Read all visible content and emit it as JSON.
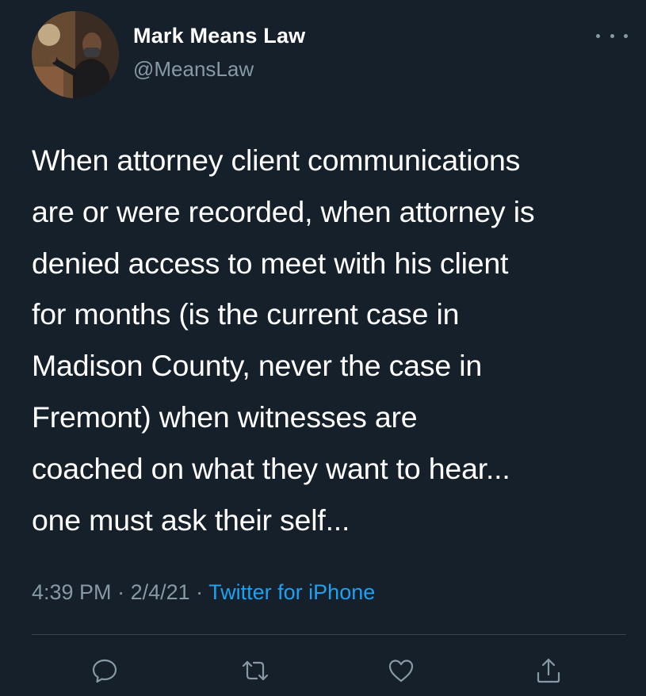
{
  "tweet": {
    "author_name": "Mark Means Law",
    "author_handle": "@MeansLaw",
    "text": "When attorney client communications\nare or were recorded,  when attorney is\ndenied access to meet with his client\nfor months (is the current case in\nMadison County, never the case in\nFremont) when witnesses are\ncoached on what they want to hear...\none must ask their self...",
    "time": "4:39 PM",
    "date": "2/4/21",
    "separator": " · ",
    "source": "Twitter for iPhone"
  },
  "icons": {
    "more": "more-horizontal-icon",
    "reply": "reply-icon",
    "retweet": "retweet-icon",
    "like": "heart-icon",
    "share": "share-icon"
  },
  "colors": {
    "background": "#15202b",
    "text": "#ffffff",
    "secondary_text": "#8899a6",
    "link": "#1da1f2",
    "divider": "#38444d"
  }
}
